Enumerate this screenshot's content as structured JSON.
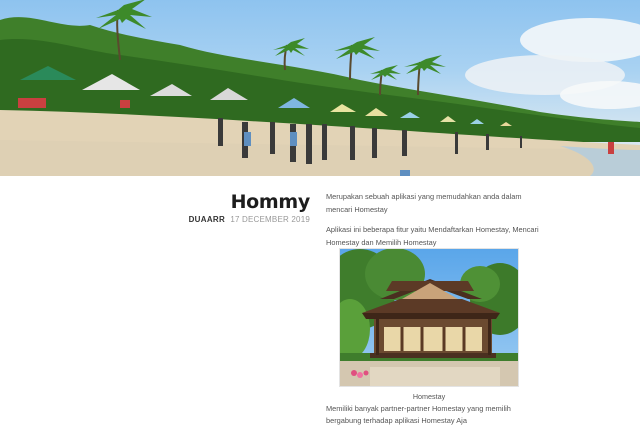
{
  "hero": {
    "image": "beach-scene"
  },
  "post": {
    "title": "Hommy",
    "author": "DUAARR",
    "date": "17 DECEMBER 2019",
    "paragraphs": [
      "Merupakan sebuah aplikasi yang memudahkan anda dalam mencari Homestay",
      "Aplikasi ini beberapa fitur yaitu Mendaftarkan Homestay, Mencari Homestay dan Memilih Homestay"
    ],
    "figure": {
      "image": "homestay-house",
      "caption": "Homestay"
    },
    "closing": "Memiliki banyak partner-partner Homestay yang memilih bergabung terhadap aplikasi Homestay Aja"
  }
}
